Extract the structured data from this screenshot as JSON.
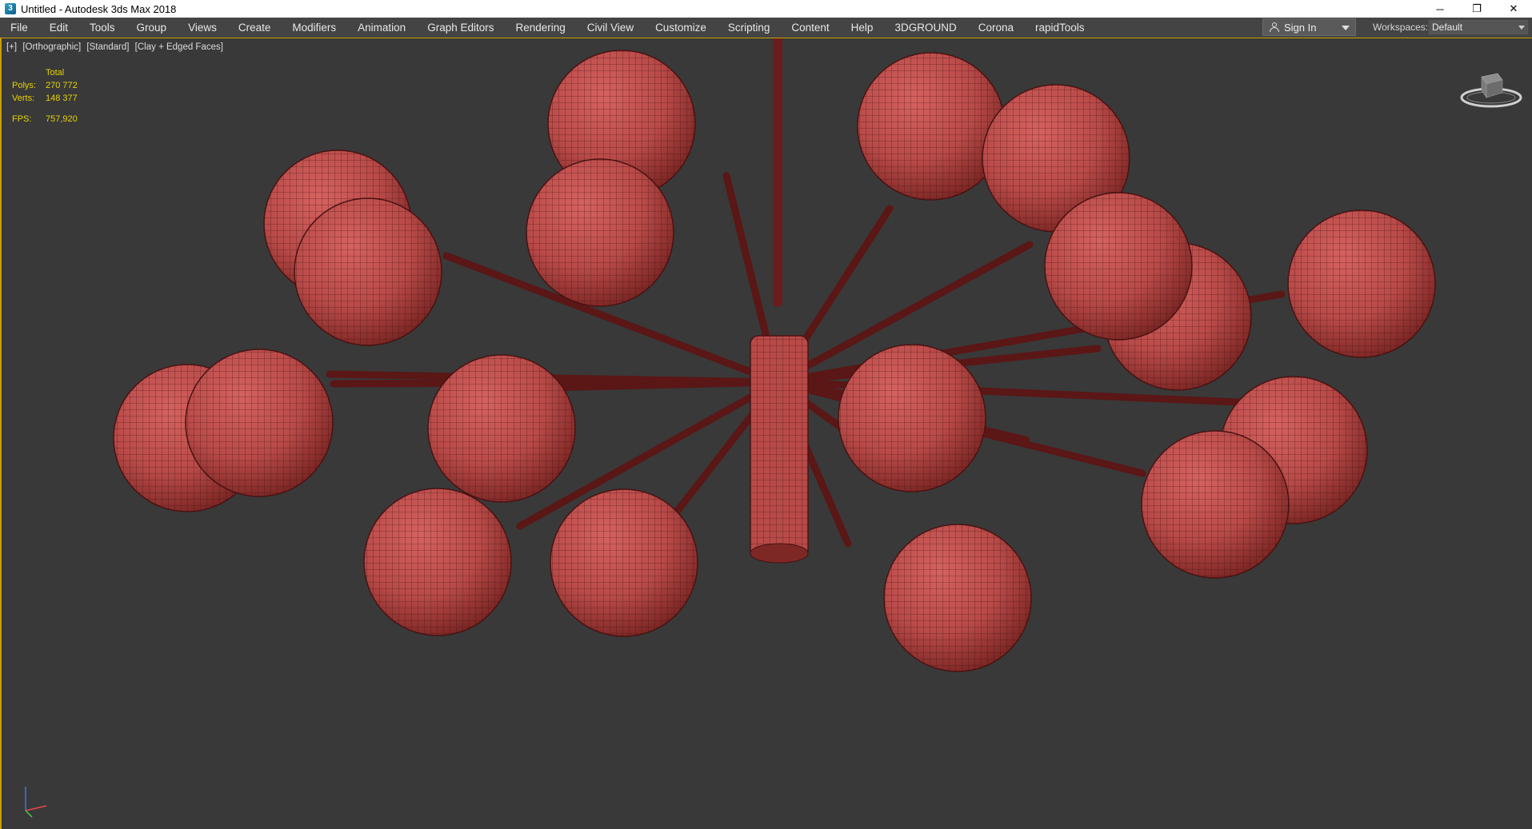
{
  "window": {
    "title": "Untitled - Autodesk 3ds Max 2018",
    "app_icon": "3ds-max-icon",
    "controls": {
      "minimize": "─",
      "restore": "❐",
      "close": "✕"
    }
  },
  "menubar": {
    "items": [
      "File",
      "Edit",
      "Tools",
      "Group",
      "Views",
      "Create",
      "Modifiers",
      "Animation",
      "Graph Editors",
      "Rendering",
      "Civil View",
      "Customize",
      "Scripting",
      "Content",
      "Help",
      "3DGROUND",
      "Corona",
      "rapidTools"
    ]
  },
  "signin": {
    "label": "Sign In",
    "icon": "user-icon"
  },
  "workspaces": {
    "label": "Workspaces:",
    "value": "Default"
  },
  "viewport": {
    "labels": [
      "[+]",
      "[Orthographic]",
      "[Standard]",
      "[Clay + Edged Faces]"
    ],
    "stats": {
      "header": "Total",
      "polys_label": "Polys:",
      "polys_value": "270 772",
      "verts_label": "Verts:",
      "verts_value": "148 377",
      "fps_label": "FPS:",
      "fps_value": "757,920"
    },
    "colors": {
      "background": "#393939",
      "clay": "#b84a48",
      "wire": "#3a0f0f",
      "stats": "#e6d300",
      "active_border": "#c8a000"
    }
  }
}
